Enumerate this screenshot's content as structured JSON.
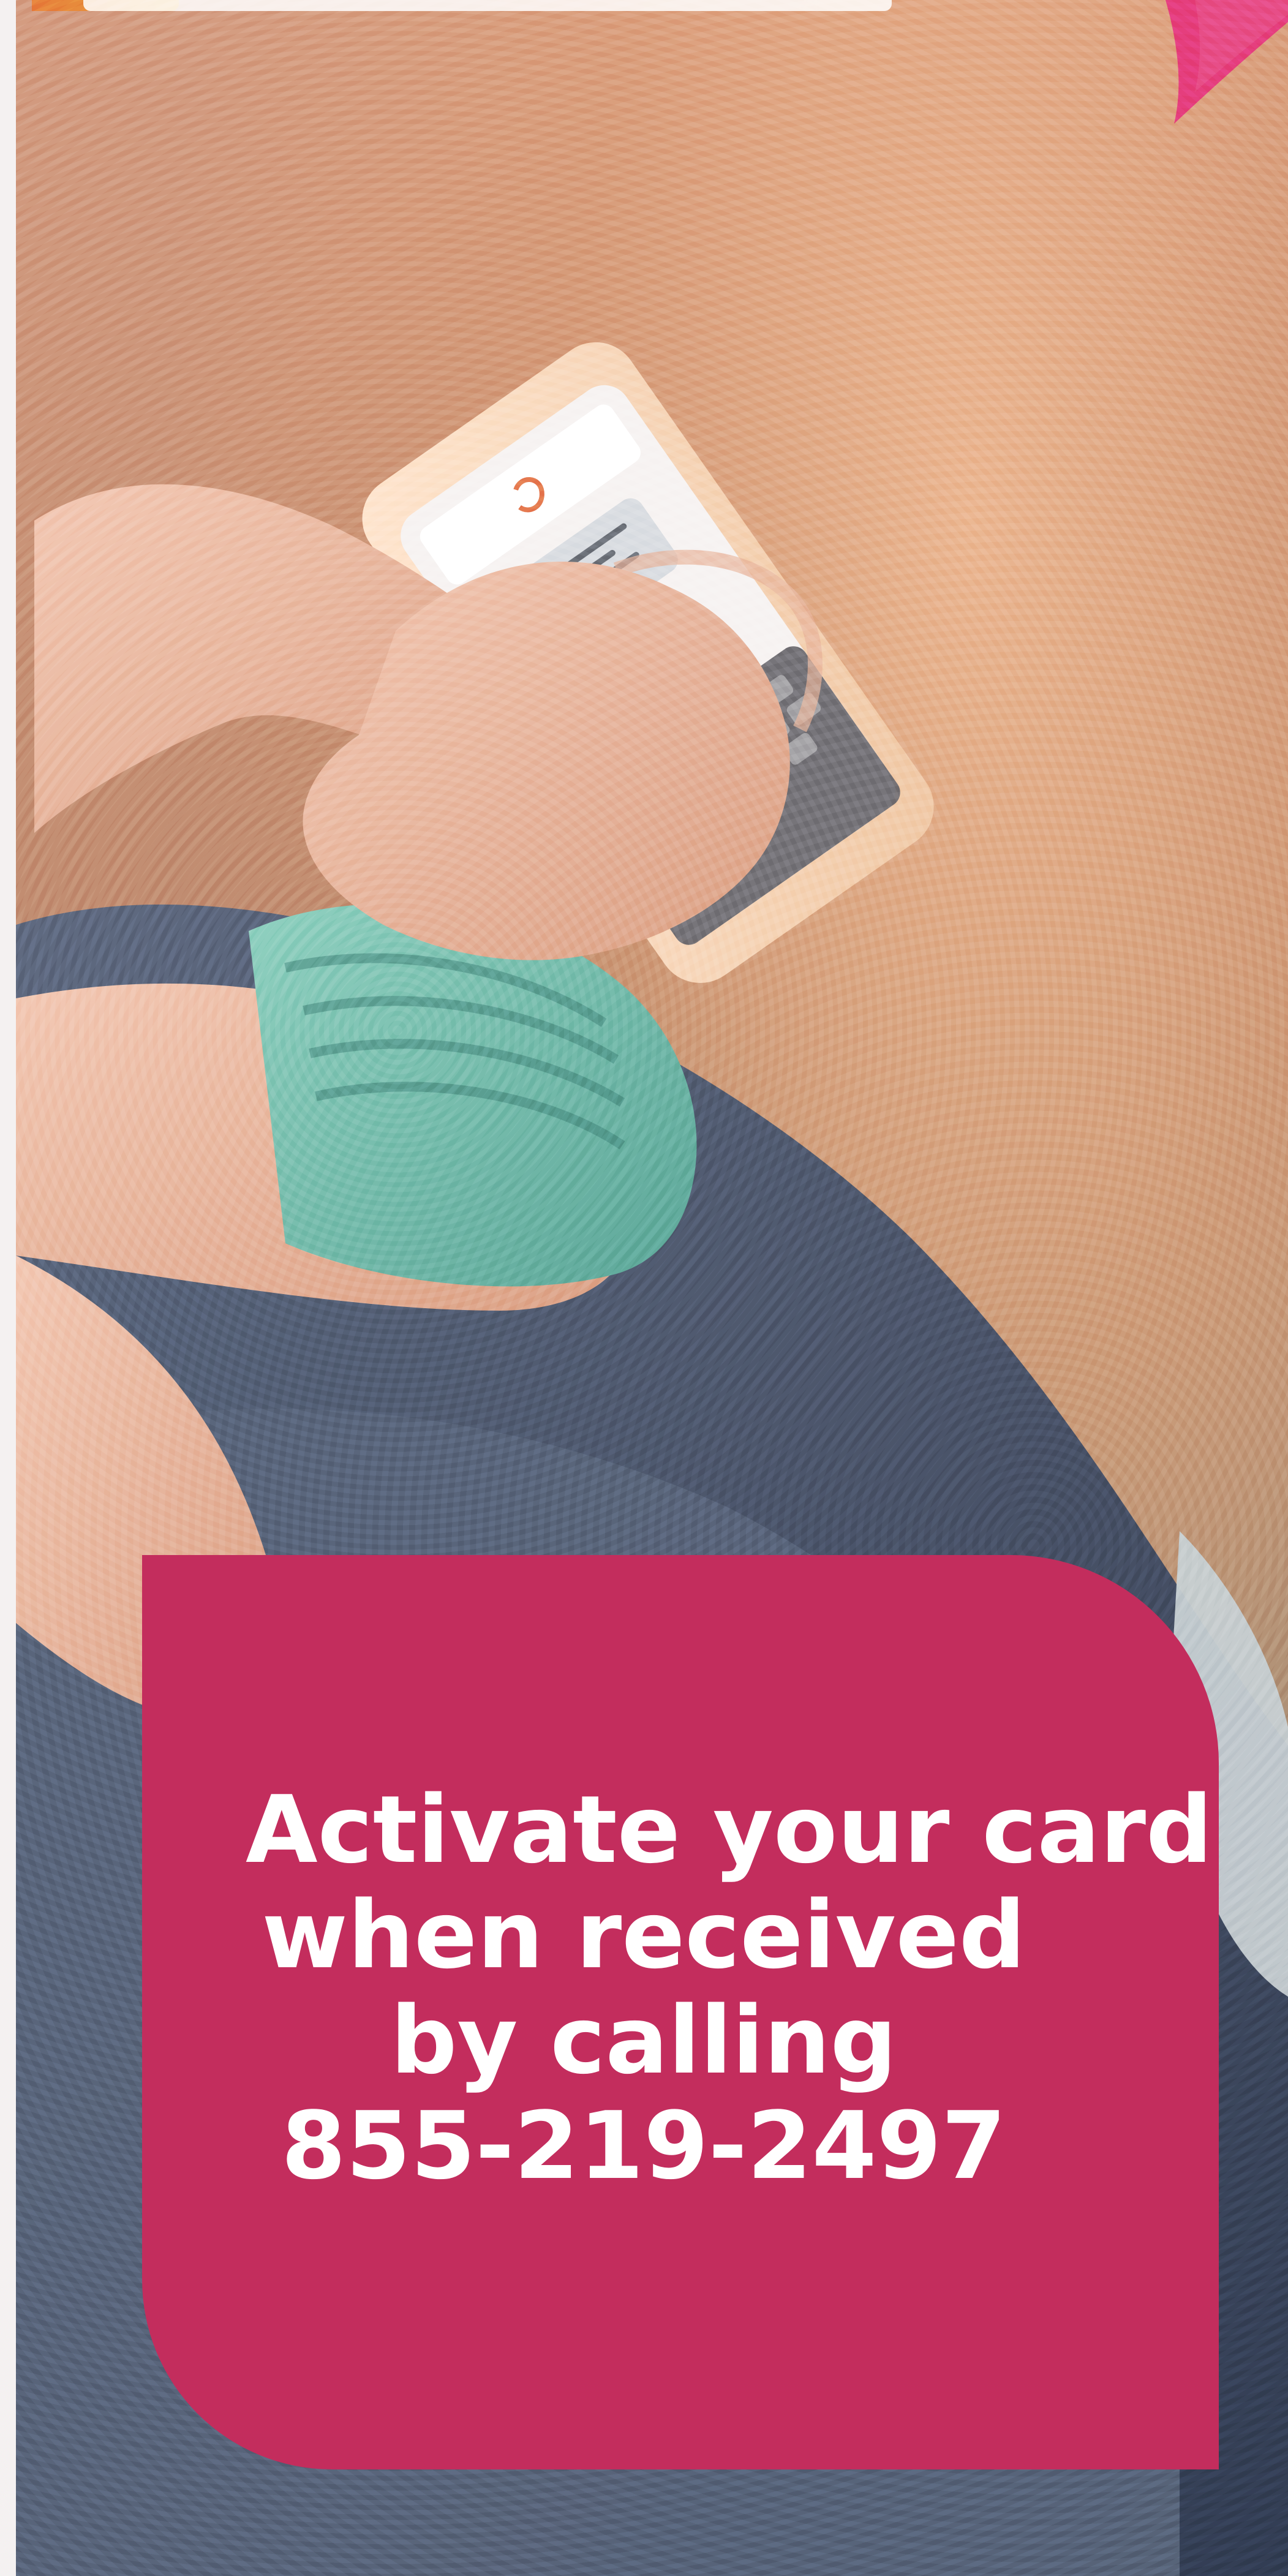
{
  "promo": {
    "message_lines": [
      "Activate your card",
      "when received",
      "by calling",
      "855-219-2497"
    ]
  },
  "colors": {
    "box": "#c32d5d",
    "text": "#ffffff",
    "pink_corner": "#e53d7b"
  },
  "icons": {
    "top_right": "pink-triangle"
  }
}
